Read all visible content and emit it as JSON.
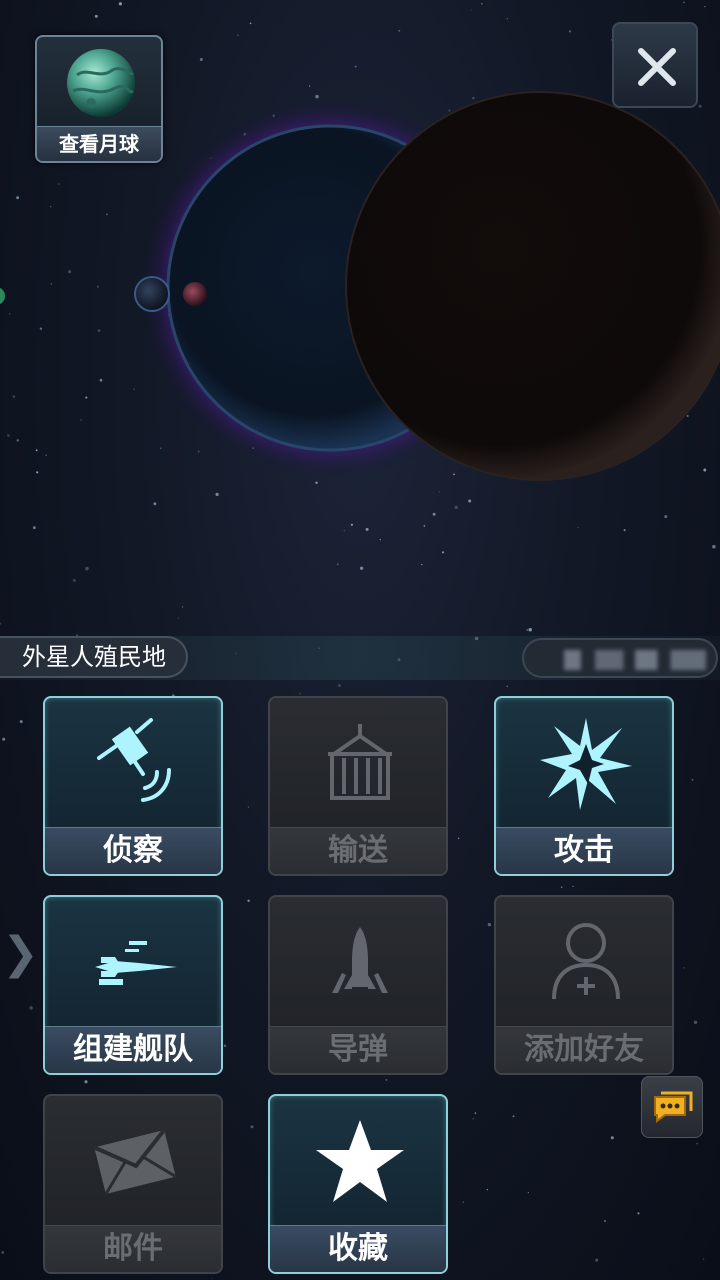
{
  "scene": {
    "view_moon_label": "查看月球"
  },
  "colony": {
    "name": "外星人殖民地"
  },
  "actions": [
    {
      "label": "侦察",
      "icon": "satellite-icon",
      "enabled": true
    },
    {
      "label": "输送",
      "icon": "cargo-container-icon",
      "enabled": false
    },
    {
      "label": "攻击",
      "icon": "explosion-icon",
      "enabled": true
    },
    {
      "label": "组建舰队",
      "icon": "spaceship-icon",
      "enabled": true
    },
    {
      "label": "导弹",
      "icon": "missile-icon",
      "enabled": false
    },
    {
      "label": "添加好友",
      "icon": "add-friend-icon",
      "enabled": false
    },
    {
      "label": "邮件",
      "icon": "mail-icon",
      "enabled": false
    },
    {
      "label": "收藏",
      "icon": "star-icon",
      "enabled": true
    }
  ],
  "colors": {
    "active_border": "#8fd0d8",
    "active_icon": "#aef4ff",
    "disabled_text": "#6a6d72",
    "planet_glow": "#a03cf0"
  }
}
